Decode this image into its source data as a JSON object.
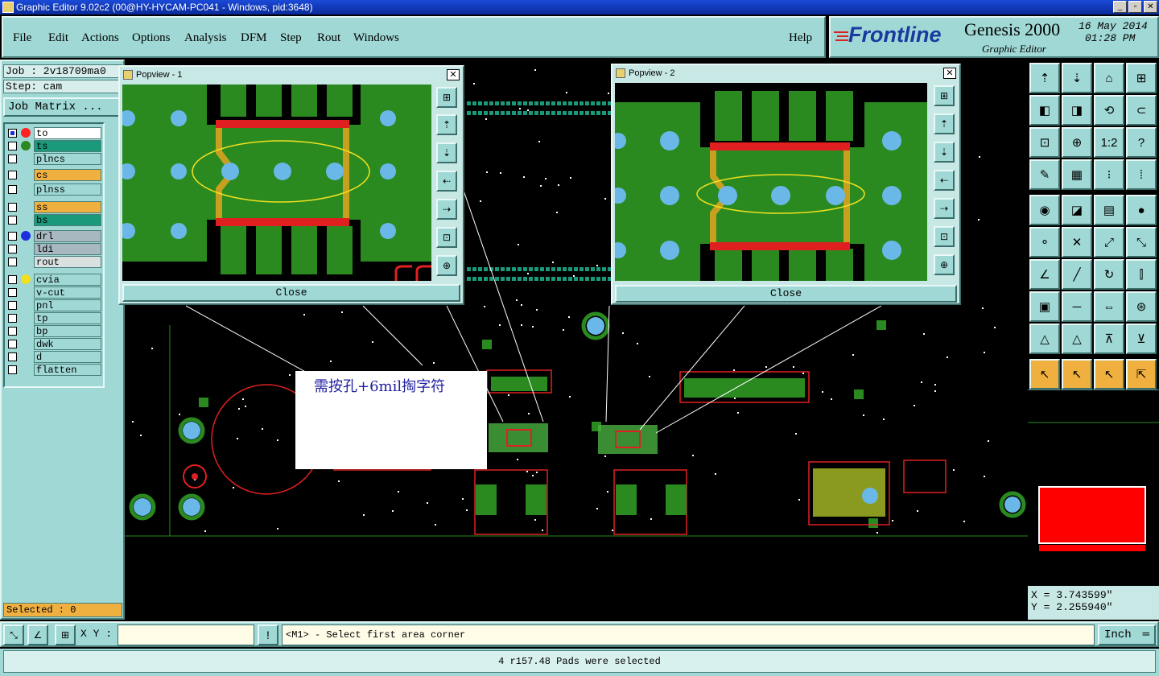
{
  "window": {
    "title": "Graphic Editor 9.02c2 (00@HY-HYCAM-PC041 - Windows, pid:3648)",
    "controls": [
      "_",
      "▫",
      "✕"
    ]
  },
  "menu": {
    "items": [
      "File",
      "Edit",
      "Actions",
      "Options",
      "Analysis",
      "DFM",
      "Step",
      "Rout",
      "Windows"
    ],
    "help": "Help"
  },
  "brand": {
    "logo": "Frontline",
    "product": "Genesis 2000",
    "subtitle": "Graphic Editor",
    "date": "16 May 2014",
    "time": "01:28 PM"
  },
  "job": {
    "job_label": "Job : 2v18709ma0",
    "step_label": "Step: cam",
    "matrix_button": "Job Matrix ..."
  },
  "layers": [
    {
      "name": "to",
      "color": "#ff2020",
      "bg": "#ffffff",
      "checked": true
    },
    {
      "name": "ts",
      "color": "#2a8a20",
      "bg": "#1a9a7a",
      "checked": false
    },
    {
      "name": "plncs",
      "color": "",
      "bg": "#9fd8d4",
      "checked": false
    },
    {
      "name": "cs",
      "color": "",
      "bg": "#f0b040",
      "checked": false
    },
    {
      "name": "plnss",
      "color": "",
      "bg": "#9fd8d4",
      "checked": false
    },
    {
      "name": "ss",
      "color": "",
      "bg": "#f0b040",
      "checked": false
    },
    {
      "name": "bs",
      "color": "",
      "bg": "#1a9a7a",
      "checked": false
    },
    {
      "name": "drl",
      "color": "#1a30e0",
      "bg": "#a8b8c0",
      "checked": false
    },
    {
      "name": "ldi",
      "color": "",
      "bg": "#a8b8c0",
      "checked": false
    },
    {
      "name": "rout",
      "color": "",
      "bg": "#d8e0e0",
      "checked": false
    },
    {
      "name": "cvia",
      "color": "#f0e020",
      "bg": "#9fd8d4",
      "checked": false
    },
    {
      "name": "v-cut",
      "color": "",
      "bg": "#9fd8d4",
      "checked": false
    },
    {
      "name": "pnl",
      "color": "",
      "bg": "#9fd8d4",
      "checked": false
    },
    {
      "name": "tp",
      "color": "",
      "bg": "#9fd8d4",
      "checked": false
    },
    {
      "name": "bp",
      "color": "",
      "bg": "#9fd8d4",
      "checked": false
    },
    {
      "name": "dwk",
      "color": "",
      "bg": "#9fd8d4",
      "checked": false
    },
    {
      "name": "d",
      "color": "",
      "bg": "#9fd8d4",
      "checked": false
    },
    {
      "name": "flatten",
      "color": "",
      "bg": "#9fd8d4",
      "checked": false
    }
  ],
  "selected_label": "Selected : 0",
  "popview1": {
    "title": "Popview - 1",
    "close": "Close"
  },
  "popview2": {
    "title": "Popview - 2",
    "close": "Close"
  },
  "annotation": "需按孔+6mil掏字符",
  "coords": {
    "x": "X = 3.743599\"",
    "y": "Y = 2.255940\""
  },
  "toolbar": {
    "xy_label": "X Y :",
    "xy_value": "",
    "prompt": "<M1> - Select first area corner",
    "units": "Inch"
  },
  "status": "4 r157.48 Pads were selected",
  "right_tools": [
    "⇡",
    "⇣",
    "⌂",
    "⊞",
    "◧",
    "◨",
    "⟲",
    "⊂",
    "⊡",
    "⊕",
    "1:2",
    "?",
    "✎",
    "▦",
    "⁝",
    "⁞",
    "◉",
    "◪",
    "▤",
    "●",
    "⚬",
    "✕",
    "⤢",
    "⤡",
    "∠",
    "╱",
    "↻",
    "⫿",
    "▣",
    "─",
    "⇔",
    "⊛",
    "△",
    "△",
    "⊼",
    "⊻",
    "↖",
    "↖",
    "↖",
    "⇱"
  ]
}
